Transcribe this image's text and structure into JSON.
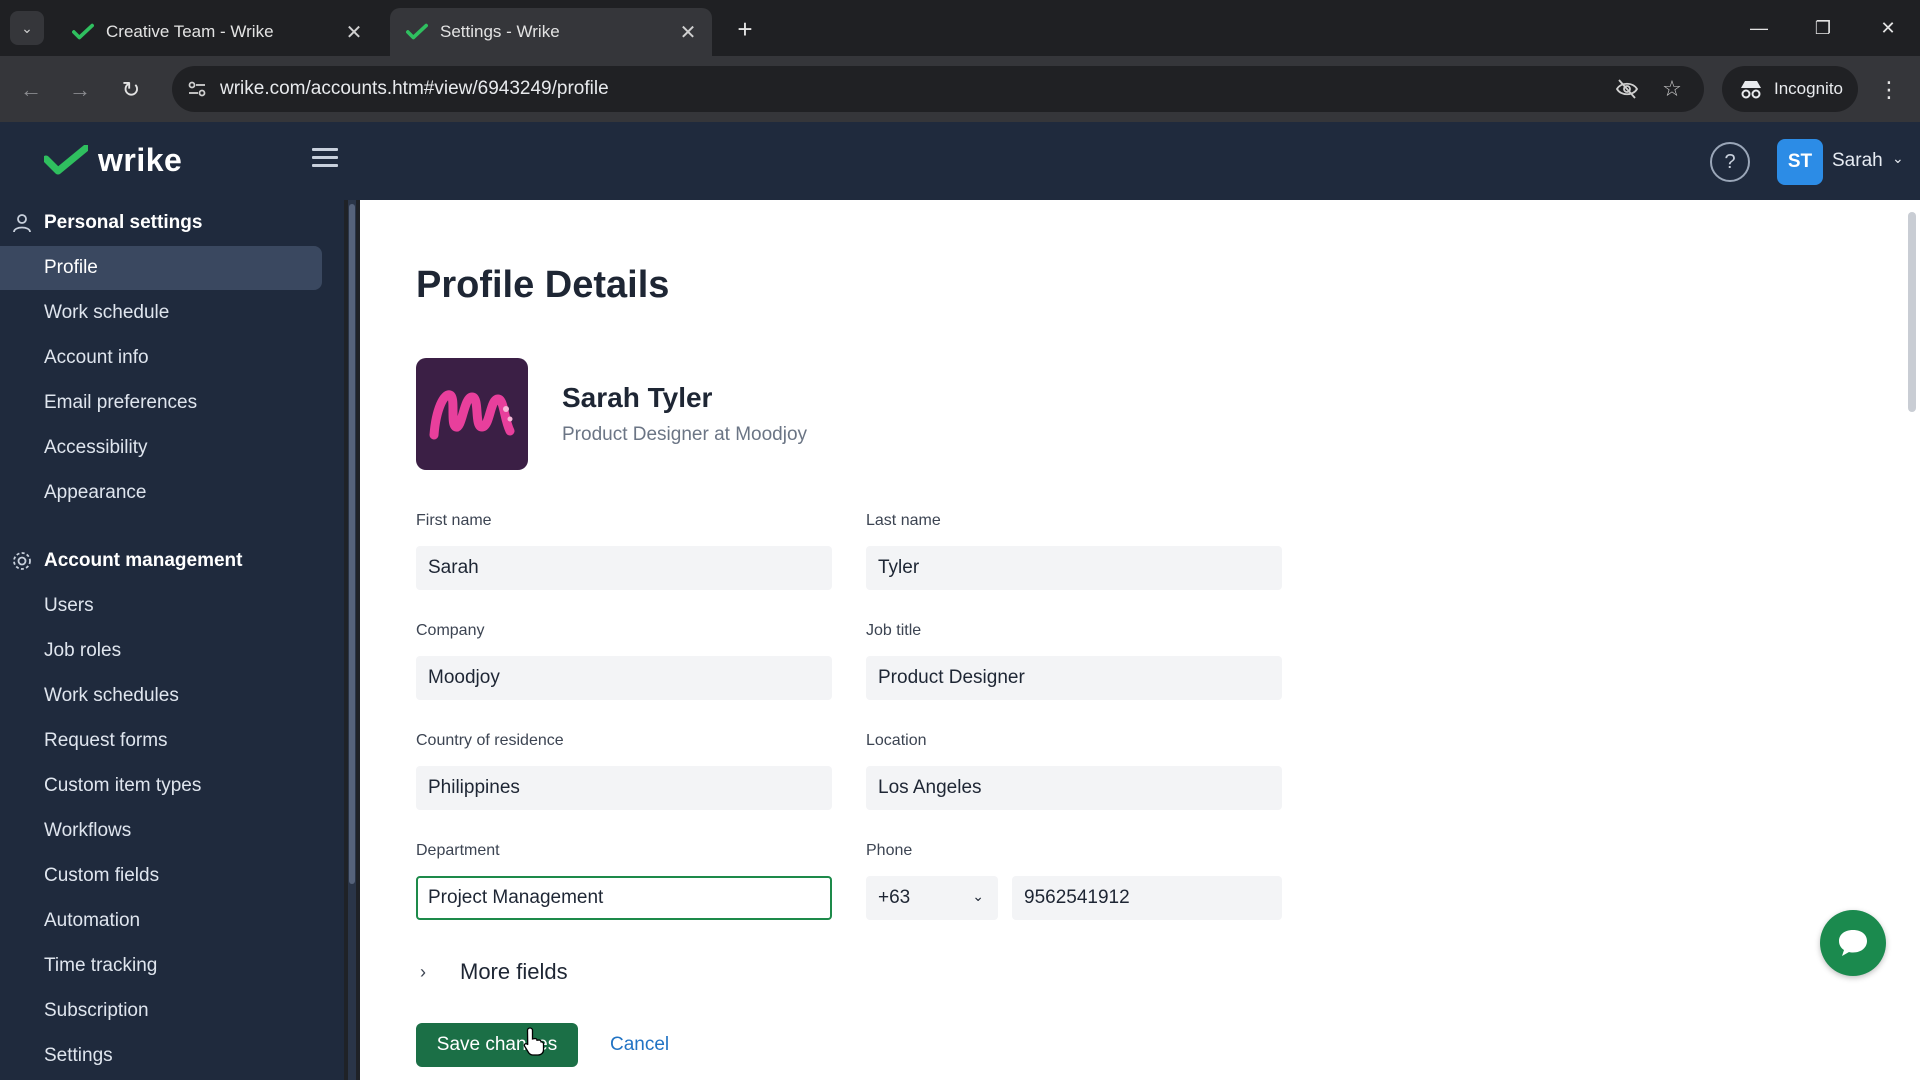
{
  "browser": {
    "tabs": [
      {
        "title": "Creative Team - Wrike",
        "active": false
      },
      {
        "title": "Settings - Wrike",
        "active": true
      }
    ],
    "url": "wrike.com/accounts.htm#view/6943249/profile",
    "incognito_label": "Incognito"
  },
  "header": {
    "logo_text": "wrike",
    "user_initials": "ST",
    "user_name": "Sarah"
  },
  "sidebar": {
    "personal_title": "Personal settings",
    "personal_items": [
      {
        "label": "Profile",
        "active": true
      },
      {
        "label": "Work schedule"
      },
      {
        "label": "Account info"
      },
      {
        "label": "Email preferences"
      },
      {
        "label": "Accessibility"
      },
      {
        "label": "Appearance"
      }
    ],
    "account_title": "Account management",
    "account_items": [
      {
        "label": "Users"
      },
      {
        "label": "Job roles"
      },
      {
        "label": "Work schedules"
      },
      {
        "label": "Request forms"
      },
      {
        "label": "Custom item types"
      },
      {
        "label": "Workflows"
      },
      {
        "label": "Custom fields"
      },
      {
        "label": "Automation"
      },
      {
        "label": "Time tracking"
      },
      {
        "label": "Subscription"
      },
      {
        "label": "Settings"
      }
    ]
  },
  "profile": {
    "page_title": "Profile Details",
    "full_name": "Sarah Tyler",
    "subtitle": "Product Designer at Moodjoy",
    "fields": {
      "first_name": {
        "label": "First name",
        "value": "Sarah"
      },
      "last_name": {
        "label": "Last name",
        "value": "Tyler"
      },
      "company": {
        "label": "Company",
        "value": "Moodjoy"
      },
      "job_title": {
        "label": "Job title",
        "value": "Product Designer"
      },
      "country": {
        "label": "Country of residence",
        "value": "Philippines"
      },
      "location": {
        "label": "Location",
        "value": "Los Angeles"
      },
      "department": {
        "label": "Department",
        "value": "Project Management"
      },
      "phone": {
        "label": "Phone",
        "country_code": "+63",
        "value": "9562541912"
      }
    },
    "more_fields_label": "More fields",
    "save_label": "Save changes",
    "cancel_label": "Cancel"
  },
  "colors": {
    "sidebar_bg": "#1f2a3d",
    "brand_green": "#1b6f46",
    "link_blue": "#2173c4",
    "avatar_blue": "#2c8ce6"
  }
}
